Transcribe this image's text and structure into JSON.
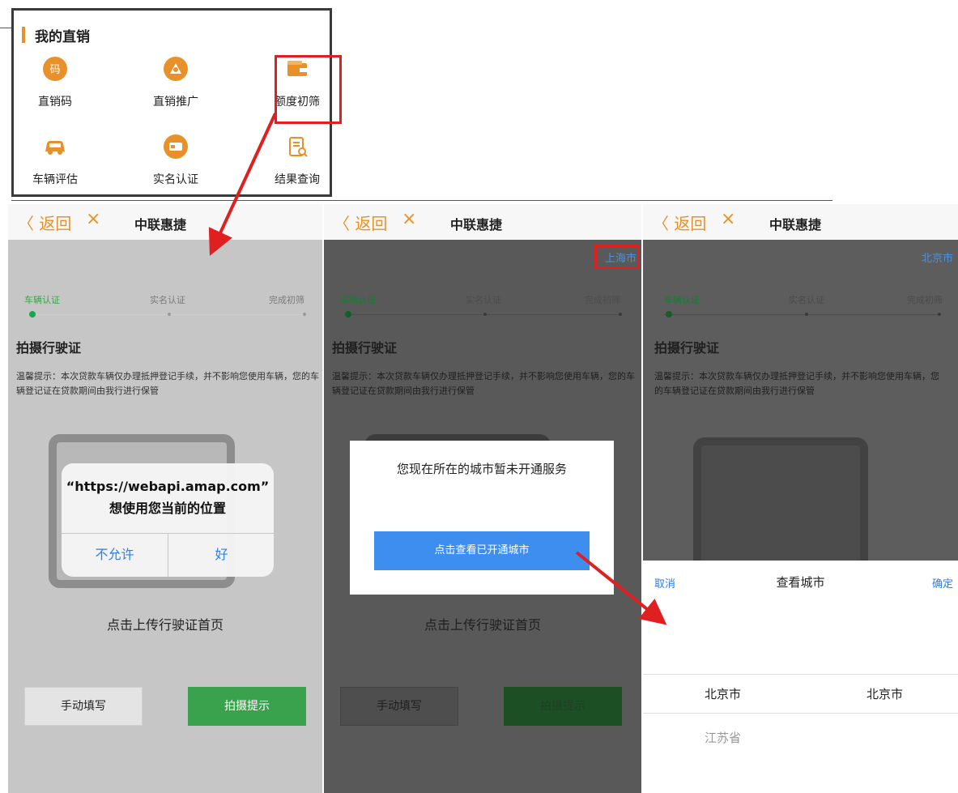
{
  "menu": {
    "title": "我的直销",
    "items": [
      {
        "label": "直销码",
        "icon": "qr-code-icon"
      },
      {
        "label": "直销推广",
        "icon": "promotion-icon"
      },
      {
        "label": "额度初筛",
        "icon": "wallet-icon"
      },
      {
        "label": "车辆评估",
        "icon": "car-icon"
      },
      {
        "label": "实名认证",
        "icon": "id-card-icon"
      },
      {
        "label": "结果查询",
        "icon": "clipboard-search-icon"
      }
    ]
  },
  "navbar": {
    "back_label": "〈 返回",
    "close_icon": "×",
    "title": "中联惠捷"
  },
  "steps": [
    "车辆认证",
    "实名认证",
    "完成初筛"
  ],
  "section_title": "拍摄行驶证",
  "tip": "温馨提示：本次贷款车辆仅办理抵押登记手续，并不影响您使用车辆，您的车辆登记证在贷款期间由我行进行保管",
  "upload_text": "点击上传行驶证首页",
  "manual_button": "手动填写",
  "shoot_button": "拍摄提示",
  "phone1": {
    "alert": {
      "title": "“https://webapi.amap.com”",
      "subtitle": "想使用您当前的位置",
      "deny": "不允许",
      "allow": "好"
    }
  },
  "phone2": {
    "city": "上海市",
    "modal_text": "您现在所在的城市暂未开通服务",
    "modal_button": "点击查看已开通城市"
  },
  "phone3": {
    "city": "北京市",
    "picker": {
      "cancel": "取消",
      "title": "查看城市",
      "ok": "确定",
      "province_selected": "北京市",
      "city_selected": "北京市",
      "province_next": "江苏省"
    }
  },
  "colors": {
    "accent_orange": "#e8912b",
    "green": "#3aa14c",
    "blue": "#3e8ef0",
    "highlight_red": "#e02020"
  }
}
